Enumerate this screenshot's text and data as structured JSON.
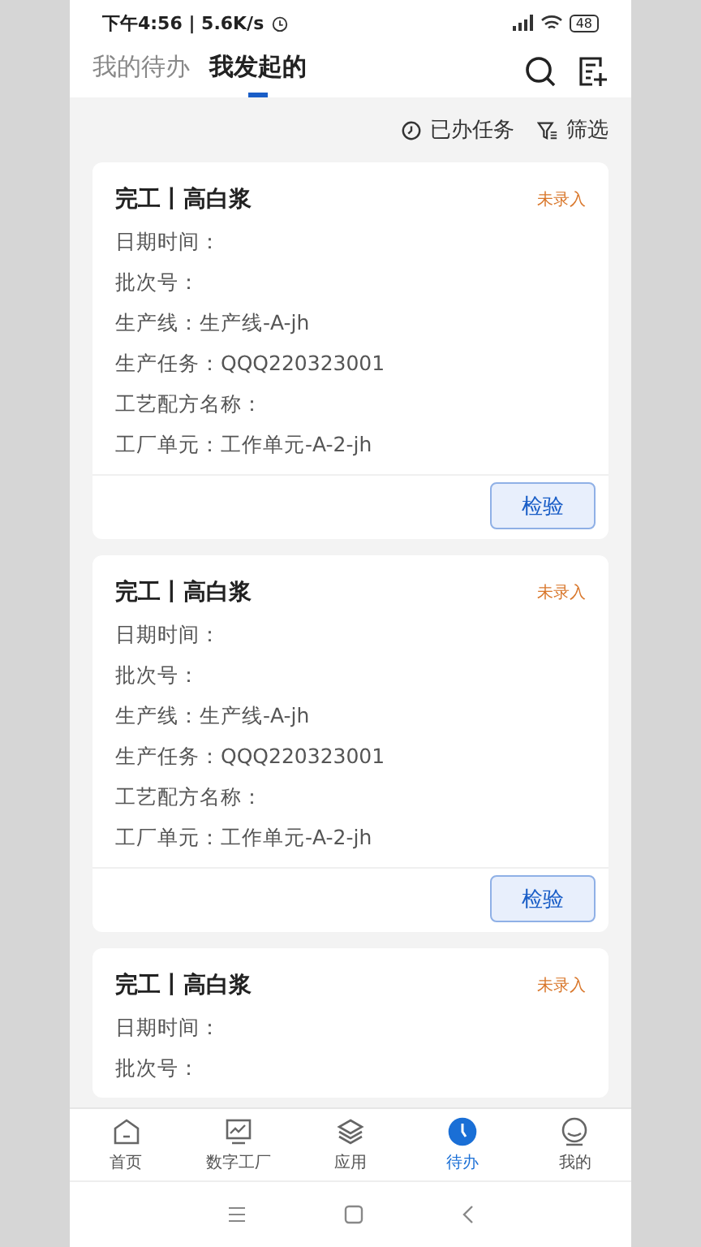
{
  "status_bar": {
    "time": "下午4:56 | 5.6K/s",
    "battery": "48"
  },
  "tabs": [
    {
      "label": "我的待办",
      "selected": false
    },
    {
      "label": "我发起的",
      "selected": true
    }
  ],
  "toolbar": [
    {
      "label": "已办任务",
      "kind": "done"
    },
    {
      "label": "筛选",
      "kind": "filter"
    }
  ],
  "cards": [
    {
      "title": "完工丨高白浆",
      "status": "未录入",
      "fields": [
        "日期时间：",
        "批次号：",
        "生产线：生产线-A-jh",
        "生产任务：QQQ220323001",
        "工艺配方名称：",
        "工厂单元：工作单元-A-2-jh"
      ],
      "button": "检验"
    },
    {
      "title": "完工丨高白浆",
      "status": "未录入",
      "fields": [
        "日期时间：",
        "批次号：",
        "生产线：生产线-A-jh",
        "生产任务：QQQ220323001",
        "工艺配方名称：",
        "工厂单元：工作单元-A-2-jh"
      ],
      "button": "检验"
    },
    {
      "title": "完工丨高白浆",
      "status": "未录入",
      "fields": [
        "日期时间：",
        "批次号："
      ]
    }
  ],
  "bottom_nav": [
    {
      "label": "首页",
      "kind": "home",
      "selected": false
    },
    {
      "label": "数字工厂",
      "kind": "chart",
      "selected": false
    },
    {
      "label": "应用",
      "kind": "layers",
      "selected": false
    },
    {
      "label": "待办",
      "kind": "clock",
      "selected": true
    },
    {
      "label": "我的",
      "kind": "face",
      "selected": false
    }
  ]
}
